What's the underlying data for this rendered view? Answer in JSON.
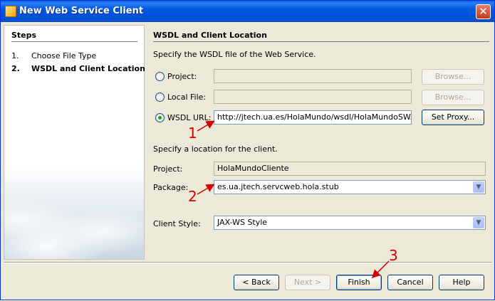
{
  "window": {
    "title": "New Web Service Client",
    "close_label": "✕"
  },
  "steps": {
    "title": "Steps",
    "items": [
      {
        "num": "1.",
        "label": "Choose File Type"
      },
      {
        "num": "2.",
        "label": "WSDL and Client Location"
      }
    ]
  },
  "main": {
    "section_title": "WSDL and Client Location",
    "wsdl_prompt": "Specify the WSDL file of the Web Service.",
    "project_label": "Project:",
    "project_value": "",
    "local_file_label": "Local File:",
    "local_file_value": "",
    "wsdl_url_label": "WSDL URL:",
    "wsdl_url_value": "http://jtech.ua.es/HolaMundo/wsdl/HolaMundoSW.wsdl",
    "browse_label": "Browse...",
    "set_proxy_label": "Set Proxy...",
    "selected_source": "WSDL URL",
    "client_prompt": "Specify a location for the client.",
    "client_project_label": "Project:",
    "client_project_value": "HolaMundoCliente",
    "package_label": "Package:",
    "package_value": "es.ua.jtech.servcweb.hola.stub",
    "client_style_label": "Client Style:",
    "client_style_value": "JAX-WS Style"
  },
  "footer": {
    "back_label": "< Back",
    "next_label": "Next >",
    "finish_label": "Finish",
    "cancel_label": "Cancel",
    "help_label": "Help"
  },
  "annotations": {
    "one": "1",
    "two": "2",
    "three": "3",
    "color": "#d40000"
  }
}
